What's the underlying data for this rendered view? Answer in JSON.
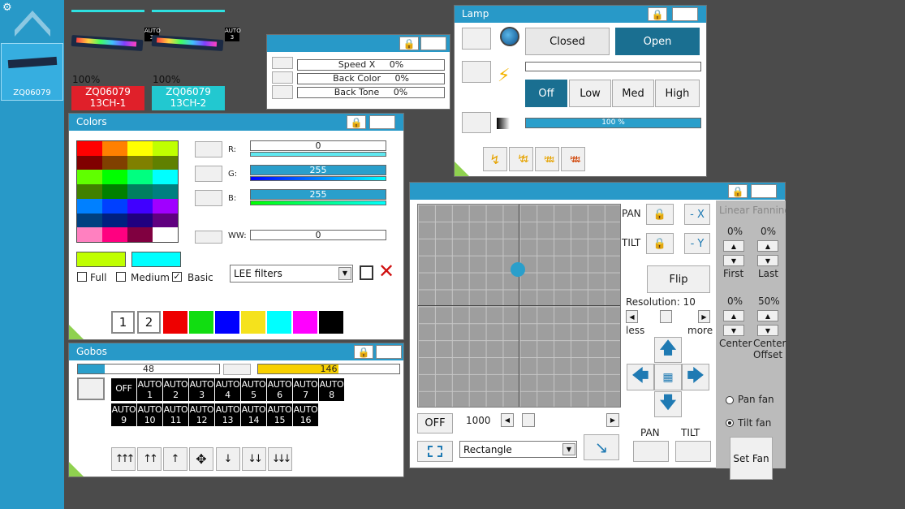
{
  "sidebar": {
    "device_label": "ZQ06079"
  },
  "fixtures": [
    {
      "percent": "100%",
      "name": "ZQ06079",
      "mode": "13CH-1",
      "color": "#e0202a",
      "badge": "AUTO 3"
    },
    {
      "percent": "100%",
      "name": "ZQ06079",
      "mode": "13CH-2",
      "color": "#22c8d0",
      "badge": "AUTO 3"
    }
  ],
  "effects": {
    "rows": [
      "Speed X     0%",
      "Back Color     0%",
      "Back Tone     0%"
    ]
  },
  "lamp": {
    "title": "Lamp",
    "closed": "Closed",
    "open": "Open",
    "fan": [
      "Off",
      "Low",
      "Med",
      "High"
    ],
    "dimmer": "100 %"
  },
  "colors": {
    "title": "Colors",
    "r_label": "R:",
    "r_value": "0",
    "g_label": "G:",
    "g_value": "255",
    "b_label": "B:",
    "b_value": "255",
    "ww_label": "WW:",
    "ww_value": "0",
    "full": "Full",
    "medium": "Medium",
    "basic": "Basic",
    "filter": "LEE filters",
    "page1": "1",
    "page2": "2",
    "grid": [
      "#ff0000",
      "#ff8000",
      "#ffff00",
      "#c0ff00",
      "#800000",
      "#804000",
      "#808000",
      "#608000",
      "#60ff00",
      "#00ff00",
      "#00ff80",
      "#00ffff",
      "#408000",
      "#008000",
      "#008060",
      "#008080",
      "#0080ff",
      "#0040ff",
      "#4000ff",
      "#a000ff",
      "#004080",
      "#002080",
      "#200080",
      "#600080",
      "#ff80c0",
      "#ff0080",
      "#800040",
      "#ffffff"
    ],
    "current_1": "#c0ff00",
    "current_2": "#00ffff",
    "swatches": [
      "#ee0000",
      "#11dd11",
      "#0000ff",
      "#f5e21c",
      "#00ffff",
      "#ff00ff",
      "#000000"
    ]
  },
  "gobos": {
    "title": "Gobos",
    "slider1": "48",
    "slider2": "146",
    "off": "OFF",
    "auto_label": "AUTO",
    "items": [
      "1",
      "2",
      "3",
      "4",
      "5",
      "6",
      "7",
      "8",
      "9",
      "10",
      "11",
      "12",
      "13",
      "14",
      "15",
      "16"
    ]
  },
  "position": {
    "pan": "PAN",
    "tilt": "TILT",
    "minus_x": "- X",
    "minus_y": "- Y",
    "flip": "Flip",
    "resolution": "Resolution: 10",
    "less": "less",
    "more": "more",
    "off": "OFF",
    "speed": "1000",
    "shape": "Rectangle",
    "pan_bottom": "PAN",
    "tilt_bottom": "TILT"
  },
  "fanning": {
    "title": "Linear Fanning",
    "first_val": "0%",
    "last_val": "0%",
    "first": "First",
    "last": "Last",
    "center_val": "0%",
    "offset_val": "50%",
    "center": "Center",
    "offset": "Center Offset",
    "pan_fan": "Pan fan",
    "tilt_fan": "Tilt fan",
    "set_fan": "Set Fan"
  }
}
